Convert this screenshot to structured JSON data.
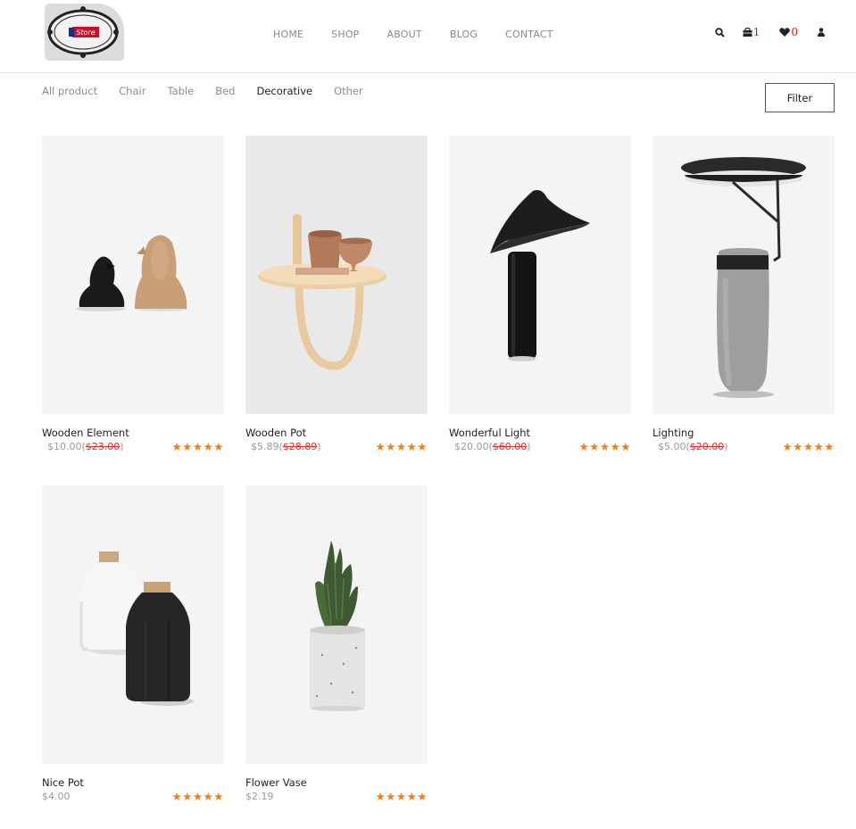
{
  "brand": {
    "logo_text": "Store"
  },
  "nav": [
    "HOME",
    "SHOP",
    "ABOUT",
    "BLOG",
    "CONTACT"
  ],
  "header_icons": {
    "cart_count": "1",
    "wishlist_count": "0"
  },
  "categories": [
    "All product",
    "Chair",
    "Table",
    "Bed",
    "Decorative",
    "Other"
  ],
  "active_category": "Decorative",
  "filter_label": "Filter",
  "products": [
    {
      "name": "Wooden Element",
      "price": "$10.00",
      "old_price": "$23.00",
      "stars": "★★★★★"
    },
    {
      "name": "Wooden Pot",
      "price": "$5.89",
      "old_price": "$28.89",
      "stars": "★★★★★"
    },
    {
      "name": "Wonderful Light",
      "price": "$20.00",
      "old_price": "$60.00",
      "stars": "★★★★★"
    },
    {
      "name": "Lighting",
      "price": "$5.00",
      "old_price": "$20.00",
      "stars": "★★★★★"
    },
    {
      "name": "Nice Pot",
      "price": "$4.00",
      "old_price": "",
      "stars": "★★★★★"
    },
    {
      "name": "Flower Vase",
      "price": "$2.19",
      "old_price": "",
      "stars": "★★★★★"
    }
  ],
  "colors": {
    "accent_star": "#f07f1a",
    "badge_red": "#e01010",
    "old_price": "#e03030"
  }
}
